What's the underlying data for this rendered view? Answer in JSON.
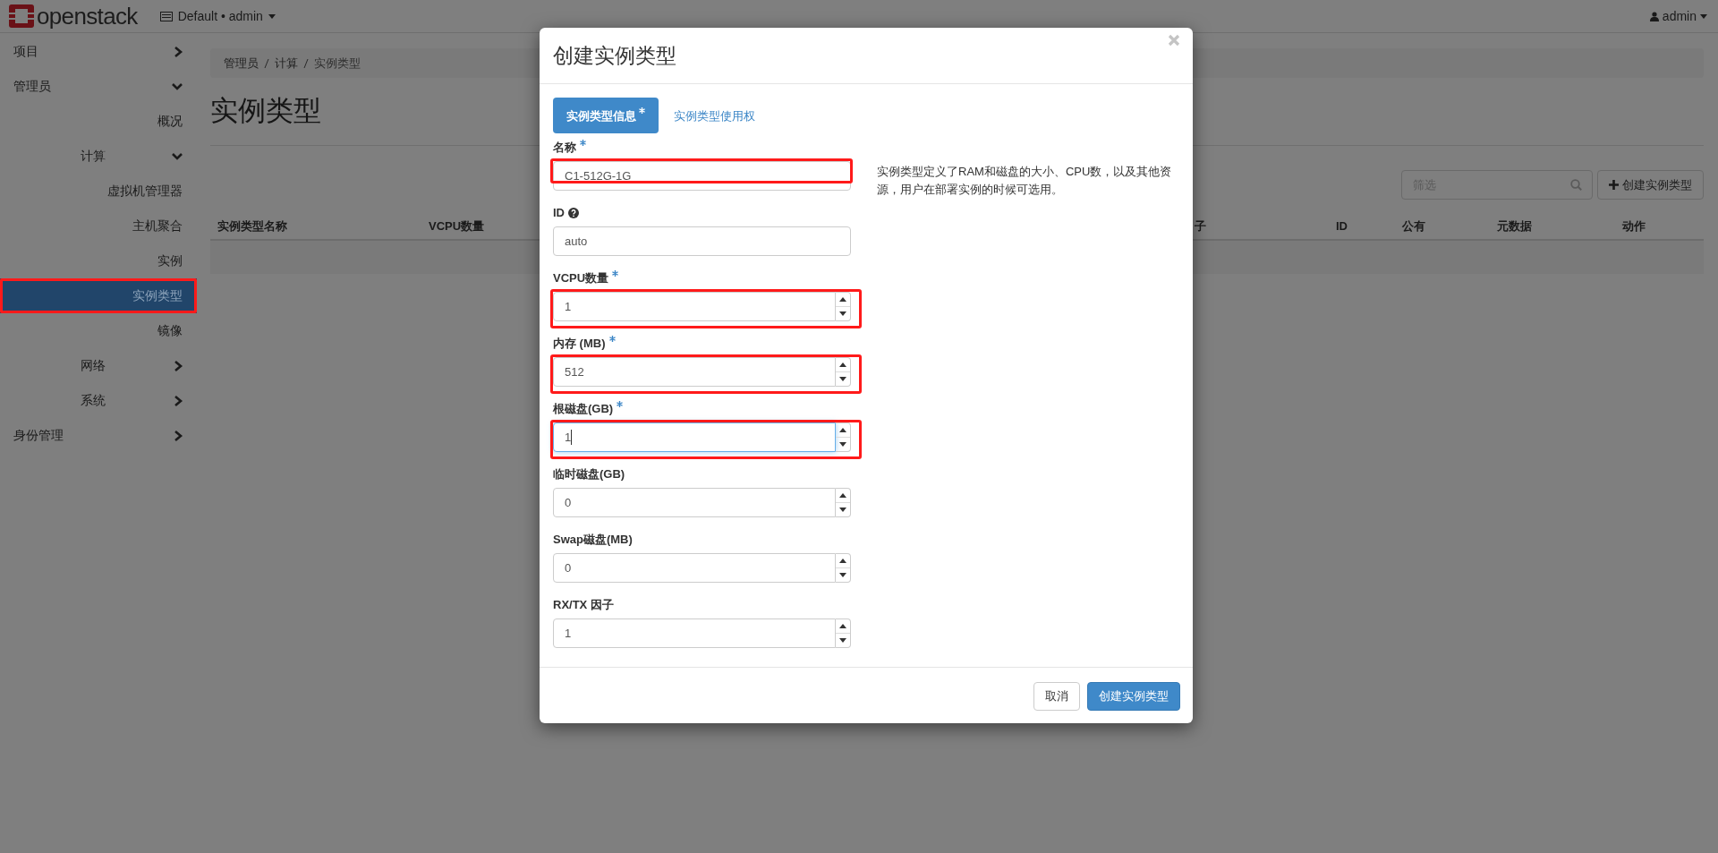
{
  "header": {
    "brand": "openstack",
    "project_menu": "Default • admin",
    "user_menu": "admin"
  },
  "sidebar": {
    "items": [
      {
        "label": "项目",
        "kind": "group",
        "expanded": false,
        "selected": false,
        "highlighted": false
      },
      {
        "label": "管理员",
        "kind": "group",
        "expanded": true,
        "selected": false,
        "highlighted": false,
        "children": [
          {
            "label": "概况",
            "kind": "link",
            "selected": false,
            "highlighted": false
          },
          {
            "label": "计算",
            "kind": "group",
            "expanded": true,
            "selected": false,
            "highlighted": false,
            "children": [
              {
                "label": "虚拟机管理器",
                "kind": "link",
                "selected": false,
                "highlighted": false
              },
              {
                "label": "主机聚合",
                "kind": "link",
                "selected": false,
                "highlighted": false
              },
              {
                "label": "实例",
                "kind": "link",
                "selected": false,
                "highlighted": false
              },
              {
                "label": "实例类型",
                "kind": "link",
                "selected": true,
                "highlighted": true
              },
              {
                "label": "镜像",
                "kind": "link",
                "selected": false,
                "highlighted": false
              }
            ]
          },
          {
            "label": "网络",
            "kind": "group",
            "expanded": false,
            "selected": false,
            "highlighted": false
          },
          {
            "label": "系统",
            "kind": "group",
            "expanded": false,
            "selected": false,
            "highlighted": false
          }
        ]
      },
      {
        "label": "身份管理",
        "kind": "group",
        "expanded": false,
        "selected": false,
        "highlighted": false
      }
    ]
  },
  "breadcrumb": [
    "管理员",
    "计算",
    "实例类型"
  ],
  "page_title": "实例类型",
  "filter": {
    "placeholder": "筛选"
  },
  "create_button": "创建实例类型",
  "table": {
    "columns": [
      "实例类型名称",
      "VCPU数量",
      "子",
      "ID",
      "公有",
      "元数据",
      "动作"
    ]
  },
  "modal": {
    "title": "创建实例类型",
    "tabs": [
      {
        "label": "实例类型信息",
        "required": true,
        "selected": true
      },
      {
        "label": "实例类型使用权",
        "required": false,
        "selected": false
      }
    ],
    "fields": [
      {
        "label": "名称",
        "kind": "text",
        "required": true,
        "help": false,
        "value": "C1-512G-1G",
        "highlighted": true,
        "focused": false
      },
      {
        "label": "ID",
        "kind": "text",
        "required": false,
        "help": true,
        "value": "auto",
        "highlighted": false,
        "focused": false
      },
      {
        "label": "VCPU数量",
        "kind": "number",
        "required": true,
        "help": false,
        "value": "1",
        "highlighted": true,
        "focused": false
      },
      {
        "label": "内存 (MB)",
        "kind": "number",
        "required": true,
        "help": false,
        "value": "512",
        "highlighted": true,
        "focused": false
      },
      {
        "label": "根磁盘(GB)",
        "kind": "number",
        "required": true,
        "help": false,
        "value": "1",
        "highlighted": true,
        "focused": true
      },
      {
        "label": "临时磁盘(GB)",
        "kind": "number",
        "required": false,
        "help": false,
        "value": "0",
        "highlighted": false,
        "focused": false
      },
      {
        "label": "Swap磁盘(MB)",
        "kind": "number",
        "required": false,
        "help": false,
        "value": "0",
        "highlighted": false,
        "focused": false
      },
      {
        "label": "RX/TX 因子",
        "kind": "number",
        "required": false,
        "help": false,
        "value": "1",
        "highlighted": false,
        "focused": false
      }
    ],
    "description": "实例类型定义了RAM和磁盘的大小、CPU数，以及其他资源，用户在部署实例的时候可选用。",
    "buttons": [
      {
        "label": "取消",
        "kind": "secondary"
      },
      {
        "label": "创建实例类型",
        "kind": "primary"
      }
    ]
  }
}
